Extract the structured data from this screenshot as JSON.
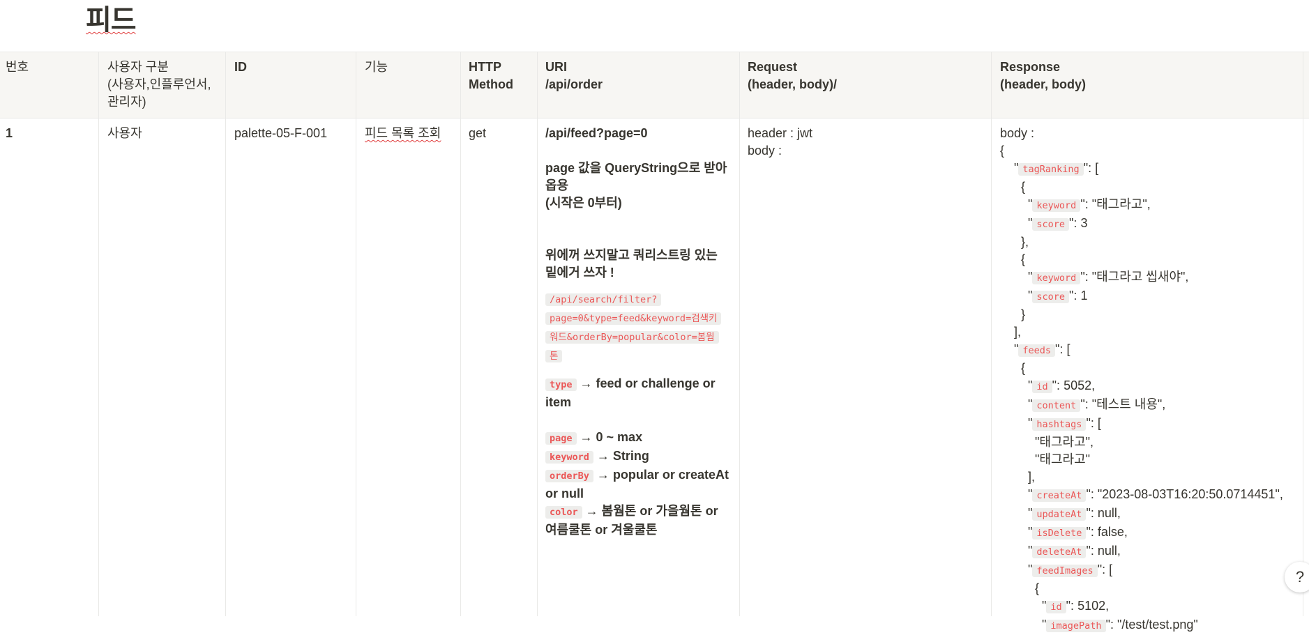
{
  "page": {
    "title": "피드"
  },
  "table": {
    "headers": [
      "번호",
      "사용자 구분\n(사용자,인플루언서,\n관리자)",
      "ID",
      "기능",
      "HTTP\nMethod",
      "URI\n/api/order",
      "Request\n(header, body)/",
      "Response\n(header, body)"
    ],
    "row": {
      "number": "1",
      "user_type": "사용자",
      "id": "palette-05-F-001",
      "feature": "피드 목록 조회",
      "method": "get",
      "uri": {
        "path": "/api/feed?page=0",
        "note1": "page 값을 QueryString으로 받아옵용",
        "note2": "(시작은 0부터)",
        "note3": "위에꺼 쓰지말고 쿼리스트링 있는 밑에거 쓰자 !",
        "code_url_1": "/api/search/filter?",
        "code_url_2": "page=0&type=feed&keyword=검색키",
        "code_url_3": "워드&orderBy=popular&color=봄웜",
        "code_url_4": "톤",
        "params": [
          {
            "name": "type",
            "desc": "→ feed or challenge or item"
          },
          {
            "name": "page",
            "desc": "→ 0 ~ max"
          },
          {
            "name": "keyword",
            "desc": "→ String"
          },
          {
            "name": "orderBy",
            "desc": "→ popular or createAt or null"
          },
          {
            "name": "color",
            "desc": "→ 봄웜톤 or 가을웜톤 or 여름쿨톤 or 겨울쿨톤"
          }
        ]
      },
      "request": {
        "header": "header :  jwt",
        "body": "body :"
      },
      "response": {
        "label": "body :",
        "open_brace": "{",
        "tagRanking_key": "tagRanking",
        "keyword_key": "keyword",
        "score_key": "score",
        "rank1_keyword": "\"태그라고\",",
        "rank1_score": "3",
        "rank2_keyword": "\"태그라고 씹새야\",",
        "rank2_score": "1",
        "feeds_key": "feeds",
        "id_key": "id",
        "feed_id": "5052,",
        "content_key": "content",
        "content_val": "\"테스트 내용\",",
        "hashtags_key": "hashtags",
        "hashtag1": "\"태그라고\",",
        "hashtag2": "\"태그라고\"",
        "createAt_key": "createAt",
        "createAt_val": "\"2023-08-03T16:20:50.0714451\",",
        "updateAt_key": "updateAt",
        "updateAt_val": "null,",
        "isDelete_key": "isDelete",
        "isDelete_val": "false,",
        "deleteAt_key": "deleteAt",
        "deleteAt_val": "null,",
        "feedImages_key": "feedImages",
        "image_id": "5102,",
        "imagePath_key": "imagePath",
        "imagePath_val": "\"/test/test.png\""
      }
    }
  },
  "help": {
    "label": "?"
  }
}
